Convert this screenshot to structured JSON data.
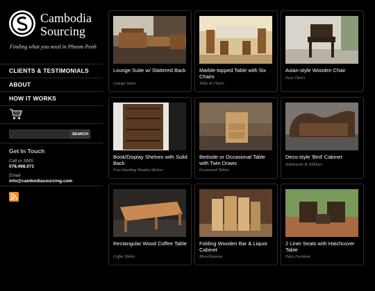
{
  "brand": {
    "title_line1": "Cambodia",
    "title_line2": "Sourcing",
    "tagline": "Finding what you need in Phnom Penh"
  },
  "nav": [
    {
      "label": "CLIENTS & TESTIMONIALS"
    },
    {
      "label": "ABOUT"
    },
    {
      "label": "HOW IT WORKS"
    }
  ],
  "icons": {
    "cart": "cart-icon",
    "rss": "rss-icon",
    "logo": "logo-mark-icon"
  },
  "search": {
    "placeholder": "",
    "value": "",
    "button_label": "SEARCH"
  },
  "contact": {
    "heading": "Get In Touch",
    "phone_label": "Call or SMS",
    "phone": "078.498.071",
    "email_label": "Email",
    "email": "info@cambodiasourcing.com"
  },
  "colors": {
    "background": "#000000",
    "rss": "#f58a1f"
  },
  "products": [
    {
      "title": "Lounge Suite w/ Slattered Back",
      "category": "Lounge Suites"
    },
    {
      "title": "Marble-topped Table with Six Chairs",
      "category": "Table & Chairs"
    },
    {
      "title": "Asian-style Wooden Chair",
      "category": "Easy Chairs"
    },
    {
      "title": "Book/Display Shelves with Solid Back",
      "category": "Free-Standing Wooden Shelves"
    },
    {
      "title": "Bedside or Occasional Table with Twin Draws",
      "category": "Occasional Tables"
    },
    {
      "title": "Deco-style 'Bird' Cabinet",
      "category": "Sideboards & Tallboys"
    },
    {
      "title": "Rectangular Wood Coffee Table",
      "category": "Coffee Tables"
    },
    {
      "title": "Folding Wooden Bar & Liquor Cabinet",
      "category": "Miscellaneous"
    },
    {
      "title": "2 Liner Seats with Hatchcover Table",
      "category": "Patio Furniture"
    }
  ]
}
